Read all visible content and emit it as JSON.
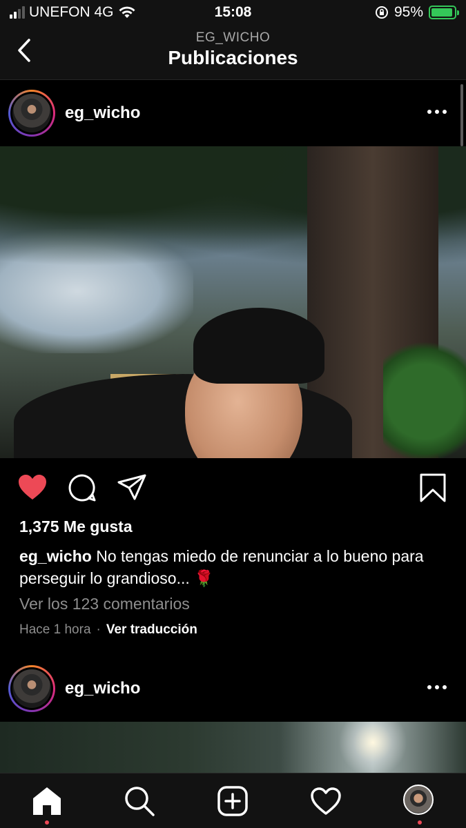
{
  "status_bar": {
    "carrier": "UNEFON 4G",
    "time": "15:08",
    "battery": "95%",
    "battery_level": 0.95
  },
  "header": {
    "subtitle": "EG_WICHO",
    "title": "Publicaciones"
  },
  "posts": [
    {
      "username": "eg_wicho",
      "likes": "1,375 Me gusta",
      "caption_user": "eg_wicho",
      "caption_text": " No tengas miedo de renunciar a lo bueno para perseguir lo grandioso... 🌹",
      "comments_link": "Ver los 123 comentarios",
      "time_ago": "Hace 1 hora",
      "separator": "·",
      "translate": "Ver traducción",
      "liked": true
    },
    {
      "username": "eg_wicho"
    }
  ],
  "colors": {
    "like_red": "#ed4956",
    "battery_green": "#34c759",
    "muted_text": "#8e8e8e"
  },
  "icons": [
    "back-chevron-icon",
    "more-icon",
    "heart-filled-icon",
    "comment-icon",
    "share-icon",
    "bookmark-icon",
    "home-icon",
    "search-icon",
    "new-post-icon",
    "activity-icon",
    "profile-icon"
  ]
}
